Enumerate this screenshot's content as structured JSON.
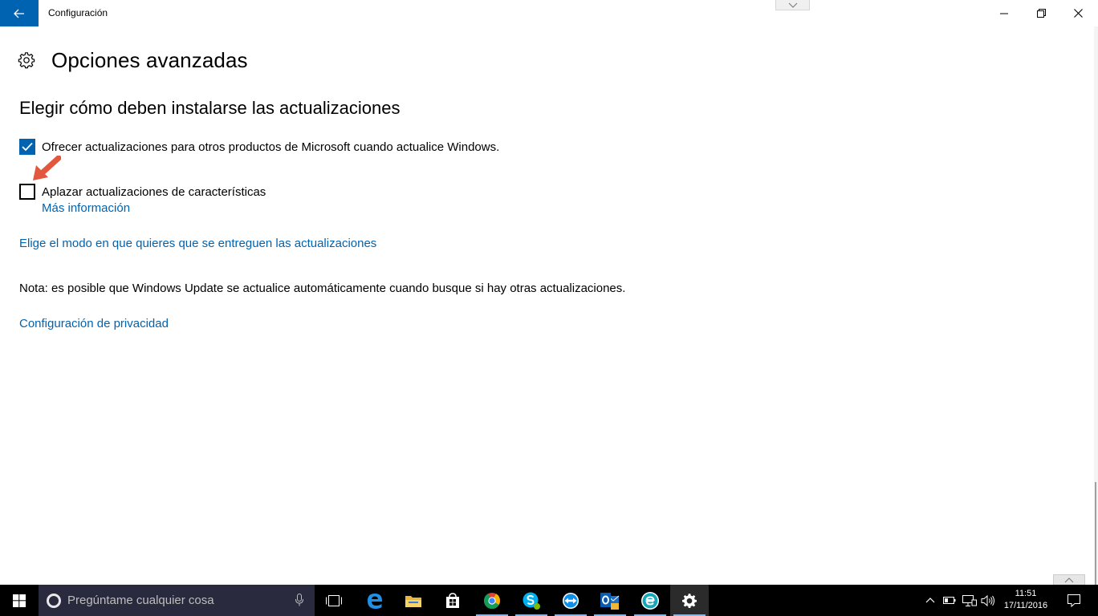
{
  "window": {
    "title": "Configuración"
  },
  "page": {
    "title": "Opciones avanzadas",
    "section_title": "Elegir cómo deben instalarse las actualizaciones",
    "options": [
      {
        "label": "Ofrecer actualizaciones para otros productos de Microsoft cuando actualice Windows.",
        "checked": true
      },
      {
        "label": "Aplazar actualizaciones de características",
        "checked": false
      }
    ],
    "more_info_link": "Más información",
    "delivery_mode_link": "Elige el modo en que quieres que se entreguen las actualizaciones",
    "note": "Nota: es posible que Windows Update se actualice automáticamente cuando busque si hay otras actualizaciones.",
    "privacy_link": "Configuración de privacidad"
  },
  "colors": {
    "accent": "#0063b1",
    "annotation_arrow": "#e2583e",
    "taskbar": "#000000"
  },
  "taskbar": {
    "search_placeholder": "Pregúntame cualquier cosa",
    "pinned": [
      "task-view-icon",
      "edge-icon",
      "file-explorer-icon",
      "store-icon",
      "chrome-icon",
      "skype-icon",
      "teamviewer-icon",
      "outlook-icon",
      "eset-icon",
      "settings-icon"
    ],
    "clock_time": "11:51",
    "clock_date": "17/11/2016"
  }
}
